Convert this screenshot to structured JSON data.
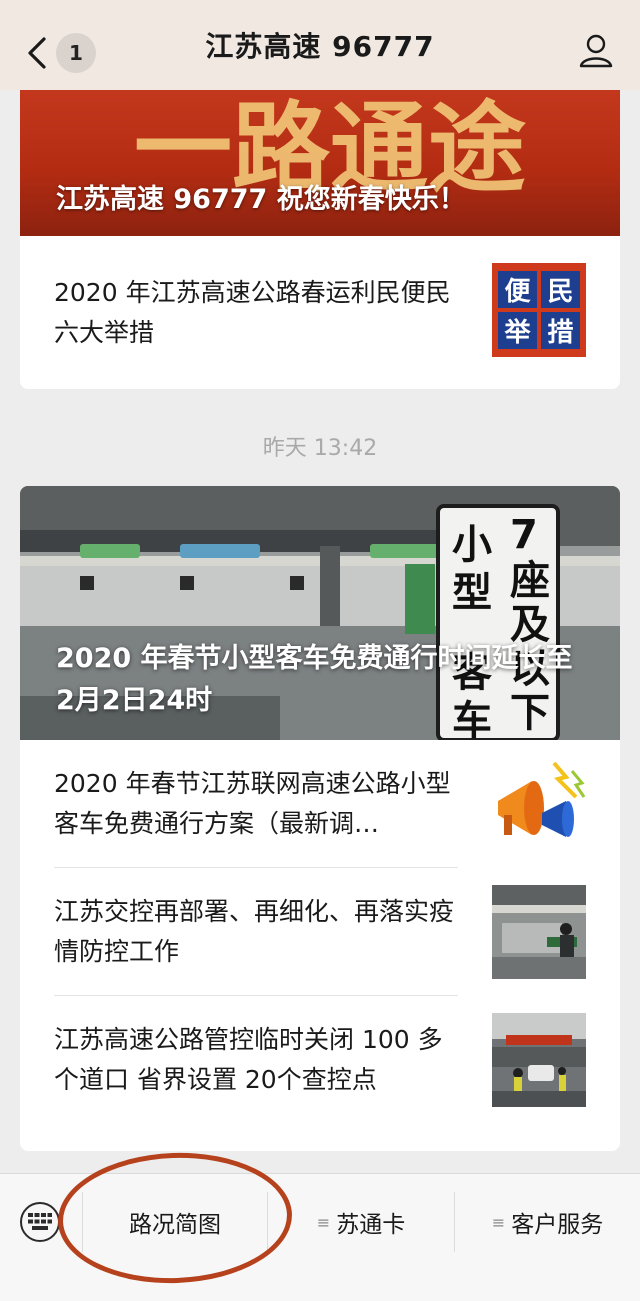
{
  "header": {
    "back_count": "1",
    "title": "江苏高速 96777"
  },
  "card1": {
    "banner_art_text": "一路通途",
    "banner_caption": "江苏高速 96777 祝您新春快乐！",
    "items": [
      {
        "title": "2020 年江苏高速公路春运利民便民六大举措",
        "thumb_text": [
          "便",
          "民",
          "举",
          "措"
        ]
      }
    ]
  },
  "time_label": "昨天 13:42",
  "card2": {
    "banner_caption": "2020 年春节小型客车免费通行时间延长至 2月2日24时",
    "banner_sign_text": [
      "7",
      "座",
      "及",
      "以",
      "下",
      "小",
      "型",
      "客",
      "车"
    ],
    "items": [
      {
        "title": "2020 年春节江苏联网高速公路小型客车免费通行方案（最新调…"
      },
      {
        "title": "江苏交控再部署、再细化、再落实疫情防控工作"
      },
      {
        "title": "江苏高速公路管控临时关闭 100 多个道口 省界设置 20个查控点"
      }
    ]
  },
  "menu": {
    "items": [
      {
        "label": "路况简图"
      },
      {
        "label": "苏通卡",
        "icon": "≡"
      },
      {
        "label": "客户服务",
        "icon": "≡"
      }
    ]
  },
  "colors": {
    "header_bg": "#f1e8e2",
    "banner_red": "#c3381d",
    "annotation": "#b5421d"
  }
}
